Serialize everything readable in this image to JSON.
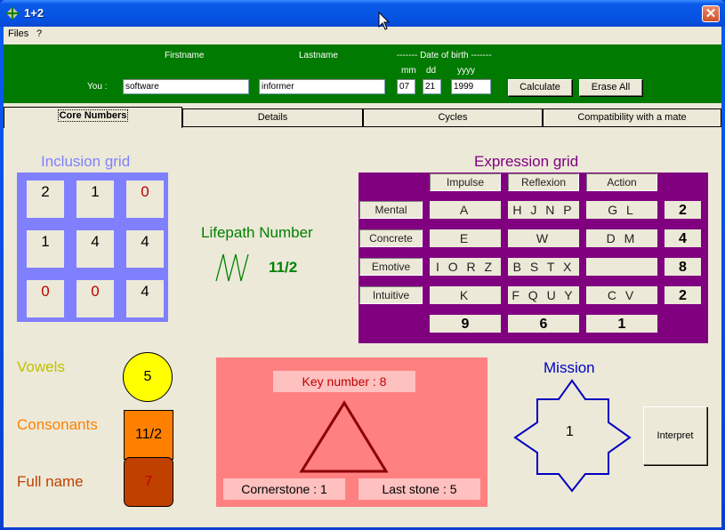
{
  "window": {
    "title": "1+2",
    "icon": "app-diamond-icon",
    "close_icon": "close-icon"
  },
  "menu": {
    "items": [
      "Files",
      "?"
    ]
  },
  "header": {
    "firstname_label": "Firstname",
    "lastname_label": "Lastname",
    "dob_label": "------- Date of birth -------",
    "mm_label": "mm",
    "dd_label": "dd",
    "yyyy_label": "yyyy",
    "you_label": "You :",
    "firstname_value": "software",
    "lastname_value": "informer",
    "mm_value": "07",
    "dd_value": "21",
    "yyyy_value": "1999",
    "calculate_label": "Calculate",
    "erase_label": "Erase All"
  },
  "tabs": [
    {
      "label": "Core Numbers",
      "active": true
    },
    {
      "label": "Details",
      "active": false
    },
    {
      "label": "Cycles",
      "active": false
    },
    {
      "label": "Compatibility with a mate",
      "active": false
    }
  ],
  "inclusion": {
    "title": "Inclusion grid",
    "cells": [
      {
        "v": "2",
        "zero": false
      },
      {
        "v": "1",
        "zero": false
      },
      {
        "v": "0",
        "zero": true
      },
      {
        "v": "1",
        "zero": false
      },
      {
        "v": "4",
        "zero": false
      },
      {
        "v": "4",
        "zero": false
      },
      {
        "v": "0",
        "zero": true
      },
      {
        "v": "0",
        "zero": true
      },
      {
        "v": "4",
        "zero": false
      }
    ],
    "colors": {
      "grid": "#8080ff",
      "zero": "#c00000",
      "normal": "#000000"
    }
  },
  "lifepath": {
    "title": "Lifepath Number",
    "value": "11/2",
    "icon": "zigzag-icon",
    "color": "#008000"
  },
  "expression": {
    "title": "Expression grid",
    "columns": [
      "Impulse",
      "Reflexion",
      "Action"
    ],
    "rows": [
      {
        "label": "Mental",
        "cells": [
          "A",
          "H J N P",
          "G L"
        ],
        "total": "2"
      },
      {
        "label": "Concrete",
        "cells": [
          "E",
          "W",
          "D M"
        ],
        "total": "4"
      },
      {
        "label": "Emotive",
        "cells": [
          "I O R Z",
          "B S T X",
          ""
        ],
        "total": "8"
      },
      {
        "label": "Intuitive",
        "cells": [
          "K",
          "F Q U Y",
          "C V"
        ],
        "total": "2"
      }
    ],
    "column_totals": [
      "9",
      "6",
      "1"
    ],
    "color": "#800080"
  },
  "numbers": {
    "vowels": {
      "label": "Vowels",
      "value": "5"
    },
    "consonants": {
      "label": "Consonants",
      "value": "11/2"
    },
    "fullname": {
      "label": "Full name",
      "value": "7"
    }
  },
  "triangle": {
    "key_number": "Key number : 8",
    "cornerstone": "Cornerstone : 1",
    "last_stone": "Last stone : 5"
  },
  "mission": {
    "title": "Mission",
    "value": "1",
    "interpret_label": "Interpret"
  }
}
